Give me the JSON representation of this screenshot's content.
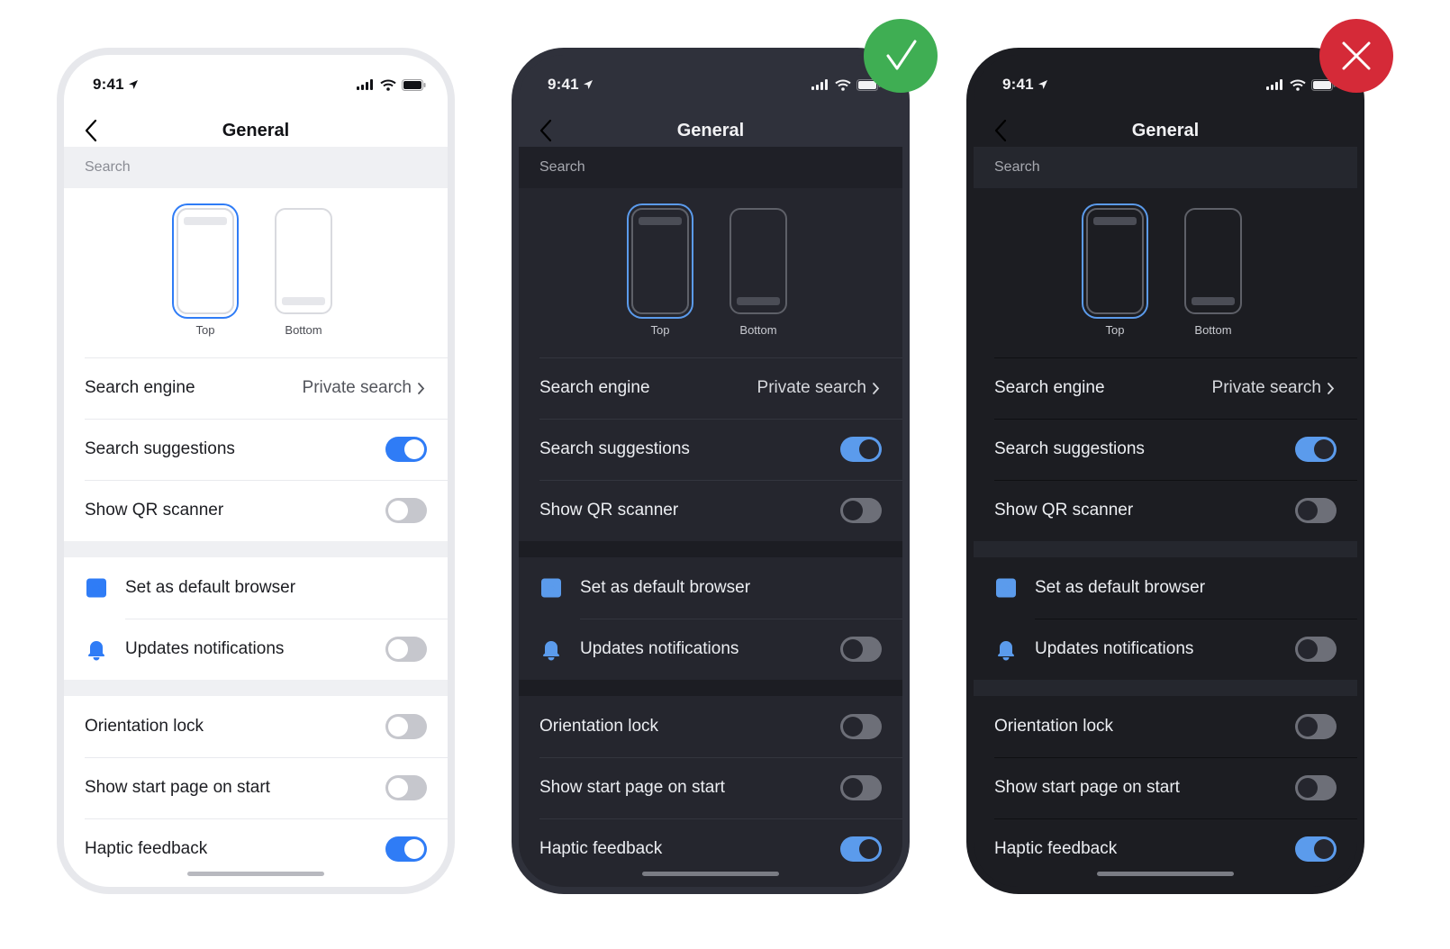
{
  "badges": {
    "good": {
      "icon": "checkmark-icon",
      "color": "#3fae53",
      "meaning": "correct"
    },
    "bad": {
      "icon": "close-x-icon",
      "color": "#d52a38",
      "meaning": "incorrect"
    }
  },
  "phones": [
    {
      "theme": "light",
      "status": {
        "time": "9:41"
      },
      "nav": {
        "title": "General"
      },
      "section_title": "Search",
      "address_bar": {
        "options": [
          {
            "label": "Top",
            "selected": true
          },
          {
            "label": "Bottom",
            "selected": false
          }
        ]
      },
      "rows": {
        "search_engine": {
          "label": "Search engine",
          "value": "Private search"
        },
        "search_suggestions": {
          "label": "Search suggestions",
          "on": true
        },
        "show_qr": {
          "label": "Show QR scanner",
          "on": false
        },
        "default_browser": {
          "label": "Set as default browser"
        },
        "updates_notifications": {
          "label": "Updates notifications",
          "on": false
        },
        "orientation_lock": {
          "label": "Orientation lock",
          "on": false
        },
        "start_page": {
          "label": "Show start page on start",
          "on": false
        },
        "haptic": {
          "label": "Haptic feedback",
          "on": true
        }
      }
    },
    {
      "theme": "dark-correct",
      "status": {
        "time": "9:41"
      },
      "nav": {
        "title": "General"
      },
      "section_title": "Search",
      "address_bar": {
        "options": [
          {
            "label": "Top",
            "selected": true
          },
          {
            "label": "Bottom",
            "selected": false
          }
        ]
      },
      "rows": {
        "search_engine": {
          "label": "Search engine",
          "value": "Private search"
        },
        "search_suggestions": {
          "label": "Search suggestions",
          "on": true
        },
        "show_qr": {
          "label": "Show QR scanner",
          "on": false
        },
        "default_browser": {
          "label": "Set as default browser"
        },
        "updates_notifications": {
          "label": "Updates notifications",
          "on": false
        },
        "orientation_lock": {
          "label": "Orientation lock",
          "on": false
        },
        "start_page": {
          "label": "Show start page on start",
          "on": false
        },
        "haptic": {
          "label": "Haptic feedback",
          "on": true
        }
      }
    },
    {
      "theme": "dark-incorrect",
      "status": {
        "time": "9:41"
      },
      "nav": {
        "title": "General"
      },
      "section_title": "Search",
      "address_bar": {
        "options": [
          {
            "label": "Top",
            "selected": true
          },
          {
            "label": "Bottom",
            "selected": false
          }
        ]
      },
      "rows": {
        "search_engine": {
          "label": "Search engine",
          "value": "Private search"
        },
        "search_suggestions": {
          "label": "Search suggestions",
          "on": true
        },
        "show_qr": {
          "label": "Show QR scanner",
          "on": false
        },
        "default_browser": {
          "label": "Set as default browser"
        },
        "updates_notifications": {
          "label": "Updates notifications",
          "on": false
        },
        "orientation_lock": {
          "label": "Orientation lock",
          "on": false
        },
        "start_page": {
          "label": "Show start page on start",
          "on": false
        },
        "haptic": {
          "label": "Haptic feedback",
          "on": true
        }
      }
    }
  ]
}
